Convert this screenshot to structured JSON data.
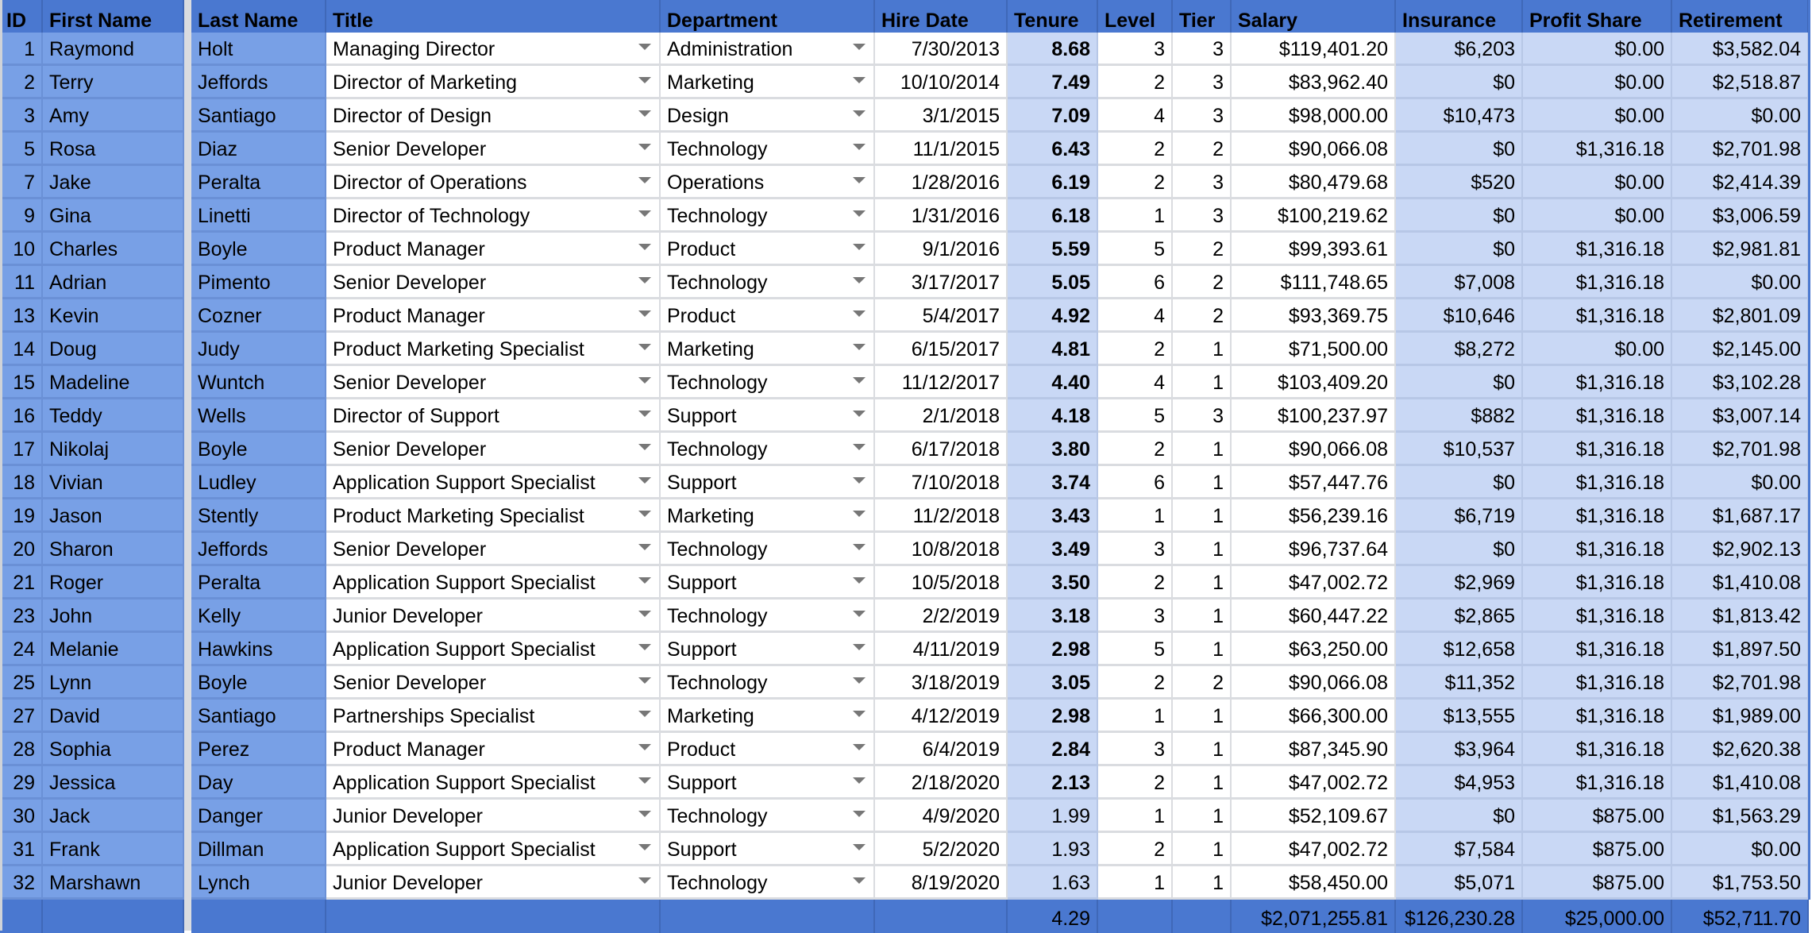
{
  "columns": [
    "ID",
    "First Name",
    "Last Name",
    "Title",
    "Department",
    "Hire Date",
    "Tenure",
    "Level",
    "Tier",
    "Salary",
    "Insurance",
    "Profit Share",
    "Retirement"
  ],
  "rows": [
    {
      "id": "1",
      "first": "Raymond",
      "last": "Holt",
      "title": "Managing Director",
      "dept": "Administration",
      "hire": "7/30/2013",
      "tenure": "8.68",
      "level": "3",
      "tier": "3",
      "salary": "$119,401.20",
      "insurance": "$6,203",
      "profit": "$0.00",
      "retirement": "$3,582.04",
      "tenure_bold": true
    },
    {
      "id": "2",
      "first": "Terry",
      "last": "Jeffords",
      "title": "Director of Marketing",
      "dept": "Marketing",
      "hire": "10/10/2014",
      "tenure": "7.49",
      "level": "2",
      "tier": "3",
      "salary": "$83,962.40",
      "insurance": "$0",
      "profit": "$0.00",
      "retirement": "$2,518.87",
      "tenure_bold": true
    },
    {
      "id": "3",
      "first": "Amy",
      "last": "Santiago",
      "title": "Director of Design",
      "dept": "Design",
      "hire": "3/1/2015",
      "tenure": "7.09",
      "level": "4",
      "tier": "3",
      "salary": "$98,000.00",
      "insurance": "$10,473",
      "profit": "$0.00",
      "retirement": "$0.00",
      "tenure_bold": true
    },
    {
      "id": "5",
      "first": "Rosa",
      "last": "Diaz",
      "title": "Senior Developer",
      "dept": "Technology",
      "hire": "11/1/2015",
      "tenure": "6.43",
      "level": "2",
      "tier": "2",
      "salary": "$90,066.08",
      "insurance": "$0",
      "profit": "$1,316.18",
      "retirement": "$2,701.98",
      "tenure_bold": true
    },
    {
      "id": "7",
      "first": "Jake",
      "last": "Peralta",
      "title": "Director of Operations",
      "dept": "Operations",
      "hire": "1/28/2016",
      "tenure": "6.19",
      "level": "2",
      "tier": "3",
      "salary": "$80,479.68",
      "insurance": "$520",
      "profit": "$0.00",
      "retirement": "$2,414.39",
      "tenure_bold": true
    },
    {
      "id": "9",
      "first": "Gina",
      "last": "Linetti",
      "title": "Director of Technology",
      "dept": "Technology",
      "hire": "1/31/2016",
      "tenure": "6.18",
      "level": "1",
      "tier": "3",
      "salary": "$100,219.62",
      "insurance": "$0",
      "profit": "$0.00",
      "retirement": "$3,006.59",
      "tenure_bold": true
    },
    {
      "id": "10",
      "first": "Charles",
      "last": "Boyle",
      "title": "Product Manager",
      "dept": "Product",
      "hire": "9/1/2016",
      "tenure": "5.59",
      "level": "5",
      "tier": "2",
      "salary": "$99,393.61",
      "insurance": "$0",
      "profit": "$1,316.18",
      "retirement": "$2,981.81",
      "tenure_bold": true
    },
    {
      "id": "11",
      "first": "Adrian",
      "last": "Pimento",
      "title": "Senior Developer",
      "dept": "Technology",
      "hire": "3/17/2017",
      "tenure": "5.05",
      "level": "6",
      "tier": "2",
      "salary": "$111,748.65",
      "insurance": "$7,008",
      "profit": "$1,316.18",
      "retirement": "$0.00",
      "tenure_bold": true
    },
    {
      "id": "13",
      "first": "Kevin",
      "last": "Cozner",
      "title": "Product Manager",
      "dept": "Product",
      "hire": "5/4/2017",
      "tenure": "4.92",
      "level": "4",
      "tier": "2",
      "salary": "$93,369.75",
      "insurance": "$10,646",
      "profit": "$1,316.18",
      "retirement": "$2,801.09",
      "tenure_bold": true
    },
    {
      "id": "14",
      "first": "Doug",
      "last": "Judy",
      "title": "Product Marketing Specialist",
      "dept": "Marketing",
      "hire": "6/15/2017",
      "tenure": "4.81",
      "level": "2",
      "tier": "1",
      "salary": "$71,500.00",
      "insurance": "$8,272",
      "profit": "$0.00",
      "retirement": "$2,145.00",
      "tenure_bold": true
    },
    {
      "id": "15",
      "first": "Madeline",
      "last": "Wuntch",
      "title": "Senior Developer",
      "dept": "Technology",
      "hire": "11/12/2017",
      "tenure": "4.40",
      "level": "4",
      "tier": "1",
      "salary": "$103,409.20",
      "insurance": "$0",
      "profit": "$1,316.18",
      "retirement": "$3,102.28",
      "tenure_bold": true
    },
    {
      "id": "16",
      "first": "Teddy",
      "last": "Wells",
      "title": "Director of Support",
      "dept": "Support",
      "hire": "2/1/2018",
      "tenure": "4.18",
      "level": "5",
      "tier": "3",
      "salary": "$100,237.97",
      "insurance": "$882",
      "profit": "$1,316.18",
      "retirement": "$3,007.14",
      "tenure_bold": true
    },
    {
      "id": "17",
      "first": "Nikolaj",
      "last": "Boyle",
      "title": "Senior Developer",
      "dept": "Technology",
      "hire": "6/17/2018",
      "tenure": "3.80",
      "level": "2",
      "tier": "1",
      "salary": "$90,066.08",
      "insurance": "$10,537",
      "profit": "$1,316.18",
      "retirement": "$2,701.98",
      "tenure_bold": true
    },
    {
      "id": "18",
      "first": "Vivian",
      "last": "Ludley",
      "title": "Application Support Specialist",
      "dept": "Support",
      "hire": "7/10/2018",
      "tenure": "3.74",
      "level": "6",
      "tier": "1",
      "salary": "$57,447.76",
      "insurance": "$0",
      "profit": "$1,316.18",
      "retirement": "$0.00",
      "tenure_bold": true
    },
    {
      "id": "19",
      "first": "Jason",
      "last": "Stently",
      "title": "Product Marketing Specialist",
      "dept": "Marketing",
      "hire": "11/2/2018",
      "tenure": "3.43",
      "level": "1",
      "tier": "1",
      "salary": "$56,239.16",
      "insurance": "$6,719",
      "profit": "$1,316.18",
      "retirement": "$1,687.17",
      "tenure_bold": true
    },
    {
      "id": "20",
      "first": "Sharon",
      "last": "Jeffords",
      "title": "Senior Developer",
      "dept": "Technology",
      "hire": "10/8/2018",
      "tenure": "3.49",
      "level": "3",
      "tier": "1",
      "salary": "$96,737.64",
      "insurance": "$0",
      "profit": "$1,316.18",
      "retirement": "$2,902.13",
      "tenure_bold": true
    },
    {
      "id": "21",
      "first": "Roger",
      "last": "Peralta",
      "title": "Application Support Specialist",
      "dept": "Support",
      "hire": "10/5/2018",
      "tenure": "3.50",
      "level": "2",
      "tier": "1",
      "salary": "$47,002.72",
      "insurance": "$2,969",
      "profit": "$1,316.18",
      "retirement": "$1,410.08",
      "tenure_bold": true
    },
    {
      "id": "23",
      "first": "John",
      "last": "Kelly",
      "title": "Junior Developer",
      "dept": "Technology",
      "hire": "2/2/2019",
      "tenure": "3.18",
      "level": "3",
      "tier": "1",
      "salary": "$60,447.22",
      "insurance": "$2,865",
      "profit": "$1,316.18",
      "retirement": "$1,813.42",
      "tenure_bold": true
    },
    {
      "id": "24",
      "first": "Melanie",
      "last": "Hawkins",
      "title": "Application Support Specialist",
      "dept": "Support",
      "hire": "4/11/2019",
      "tenure": "2.98",
      "level": "5",
      "tier": "1",
      "salary": "$63,250.00",
      "insurance": "$12,658",
      "profit": "$1,316.18",
      "retirement": "$1,897.50",
      "tenure_bold": true
    },
    {
      "id": "25",
      "first": "Lynn",
      "last": "Boyle",
      "title": "Senior Developer",
      "dept": "Technology",
      "hire": "3/18/2019",
      "tenure": "3.05",
      "level": "2",
      "tier": "2",
      "salary": "$90,066.08",
      "insurance": "$11,352",
      "profit": "$1,316.18",
      "retirement": "$2,701.98",
      "tenure_bold": true
    },
    {
      "id": "27",
      "first": "David",
      "last": "Santiago",
      "title": "Partnerships Specialist",
      "dept": "Marketing",
      "hire": "4/12/2019",
      "tenure": "2.98",
      "level": "1",
      "tier": "1",
      "salary": "$66,300.00",
      "insurance": "$13,555",
      "profit": "$1,316.18",
      "retirement": "$1,989.00",
      "tenure_bold": true
    },
    {
      "id": "28",
      "first": "Sophia",
      "last": "Perez",
      "title": "Product Manager",
      "dept": "Product",
      "hire": "6/4/2019",
      "tenure": "2.84",
      "level": "3",
      "tier": "1",
      "salary": "$87,345.90",
      "insurance": "$3,964",
      "profit": "$1,316.18",
      "retirement": "$2,620.38",
      "tenure_bold": true
    },
    {
      "id": "29",
      "first": "Jessica",
      "last": "Day",
      "title": "Application Support Specialist",
      "dept": "Support",
      "hire": "2/18/2020",
      "tenure": "2.13",
      "level": "2",
      "tier": "1",
      "salary": "$47,002.72",
      "insurance": "$4,953",
      "profit": "$1,316.18",
      "retirement": "$1,410.08",
      "tenure_bold": true
    },
    {
      "id": "30",
      "first": "Jack",
      "last": "Danger",
      "title": "Junior Developer",
      "dept": "Technology",
      "hire": "4/9/2020",
      "tenure": "1.99",
      "level": "1",
      "tier": "1",
      "salary": "$52,109.67",
      "insurance": "$0",
      "profit": "$875.00",
      "retirement": "$1,563.29",
      "tenure_bold": false
    },
    {
      "id": "31",
      "first": "Frank",
      "last": "Dillman",
      "title": "Application Support Specialist",
      "dept": "Support",
      "hire": "5/2/2020",
      "tenure": "1.93",
      "level": "2",
      "tier": "1",
      "salary": "$47,002.72",
      "insurance": "$7,584",
      "profit": "$875.00",
      "retirement": "$0.00",
      "tenure_bold": false
    },
    {
      "id": "32",
      "first": "Marshawn",
      "last": "Lynch",
      "title": "Junior Developer",
      "dept": "Technology",
      "hire": "8/19/2020",
      "tenure": "1.63",
      "level": "1",
      "tier": "1",
      "salary": "$58,450.00",
      "insurance": "$5,071",
      "profit": "$875.00",
      "retirement": "$1,753.50",
      "tenure_bold": false
    }
  ],
  "totals": {
    "tenure": "4.29",
    "salary": "$2,071,255.81",
    "insurance": "$126,230.28",
    "profit": "$25,000.00",
    "retirement": "$52,711.70"
  },
  "colors": {
    "header": "#4a78d0",
    "name_columns": "#78a0e6",
    "highlight_columns": "#c9d8f5",
    "grid": "#dadce0"
  }
}
